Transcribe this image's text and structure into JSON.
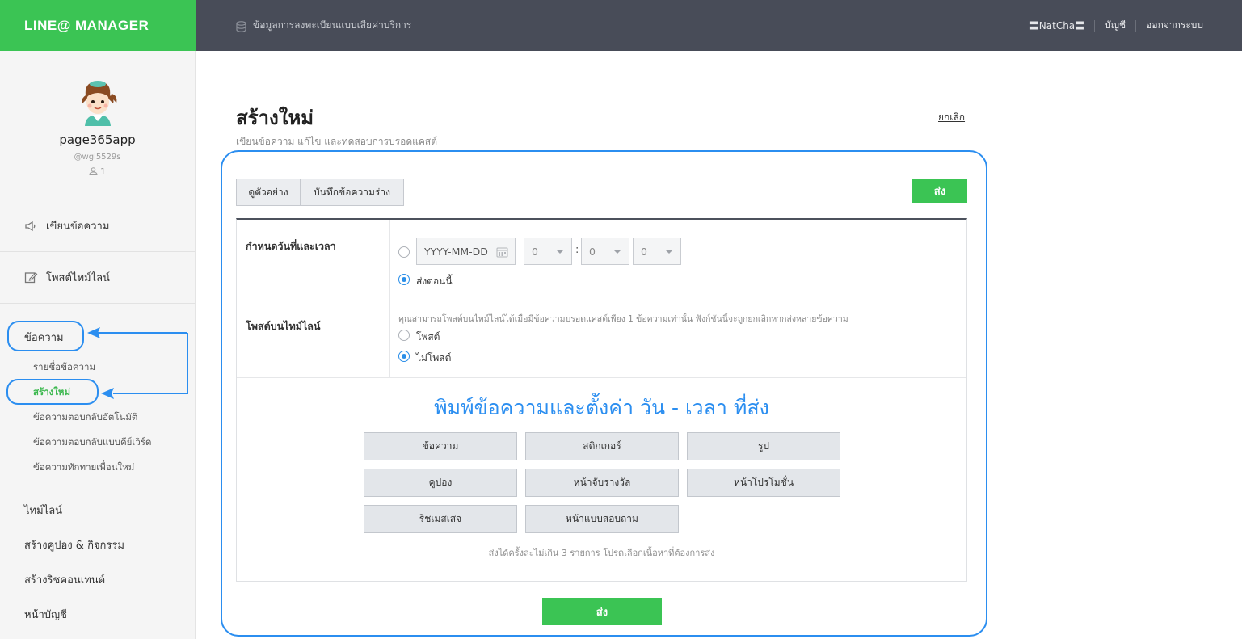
{
  "brand": {
    "name": "LINE@ MANAGER",
    "color": "#3bc454"
  },
  "topnav": {
    "crumb_icon": "database-icon",
    "crumb": "ข้อมูลการลงทะเบียนแบบเสียค่าบริการ",
    "user": "〓NatCha〓",
    "account": "บัญชี",
    "logout": "ออกจากระบบ"
  },
  "profile": {
    "name": "page365app",
    "id": "@wgl5529s",
    "friend_icon": "person-icon",
    "friends": "1"
  },
  "sidebar": {
    "write_message": {
      "icon": "megaphone-icon",
      "label": "เขียนข้อความ"
    },
    "timeline_post": {
      "icon": "edit-icon",
      "label": "โพสต์ไทม์ไลน์"
    },
    "message_section": "ข้อความ",
    "message_items": [
      {
        "label": "รายชื่อข้อความ",
        "active": false
      },
      {
        "label": "สร้างใหม่",
        "active": true
      },
      {
        "label": "ข้อความตอบกลับอัตโนมัติ",
        "active": false
      },
      {
        "label": "ข้อความตอบกลับแบบคีย์เวิร์ด",
        "active": false
      },
      {
        "label": "ข้อความทักทายเพื่อนใหม่",
        "active": false
      }
    ],
    "sections": [
      "ไทม์ไลน์",
      "สร้างคูปอง & กิจกรรม",
      "สร้างริชคอนเทนต์",
      "หน้าบัญชี"
    ]
  },
  "main": {
    "title": "สร้างใหม่",
    "subtitle": "เขียนข้อความ แก้ไข และทดสอบการบรอดแคสต์",
    "cancel": "ยกเลิก",
    "tabs": [
      "ดูตัวอย่าง",
      "บันทึกข้อความร่าง"
    ],
    "send_label": "ส่ง",
    "schedule": {
      "label": "กำหนดวันที่และเวลา",
      "date_placeholder": "YYYY-MM-DD",
      "hour": "0",
      "minute": "0",
      "second": "0",
      "separator": ":",
      "option_scheduled_selected": false,
      "option_now": "ส่งตอนนี้",
      "option_now_selected": true
    },
    "timeline": {
      "label": "โพสต์บนไทม์ไลน์",
      "hint": "คุณสามารถโพสต์บนไทม์ไลน์ได้เมื่อมีข้อความบรอดแคสต์เพียง 1 ข้อความเท่านั้น ฟังก์ชันนี้จะถูกยกเลิกหากส่งหลายข้อความ",
      "option_post": "โพสต์",
      "option_post_selected": false,
      "option_nopost": "ไม่โพสต์",
      "option_nopost_selected": true
    },
    "annotation": "พิมพ์ข้อความและตั้งค่า วัน - เวลา ที่ส่ง",
    "content_types": [
      "ข้อความ",
      "สติกเกอร์",
      "รูป",
      "คูปอง",
      "หน้าจับรางวัล",
      "หน้าโปรโมชั่น",
      "ริชเมสเสจ",
      "หน้าแบบสอบถาม"
    ],
    "limit_note": "ส่งได้ครั้งละไม่เกิน 3 รายการ โปรดเลือกเนื้อหาที่ต้องการส่ง"
  },
  "colors": {
    "accent_green": "#3bc454",
    "annotation_blue": "#2b8ef0",
    "topbar_dark": "#484c58"
  }
}
